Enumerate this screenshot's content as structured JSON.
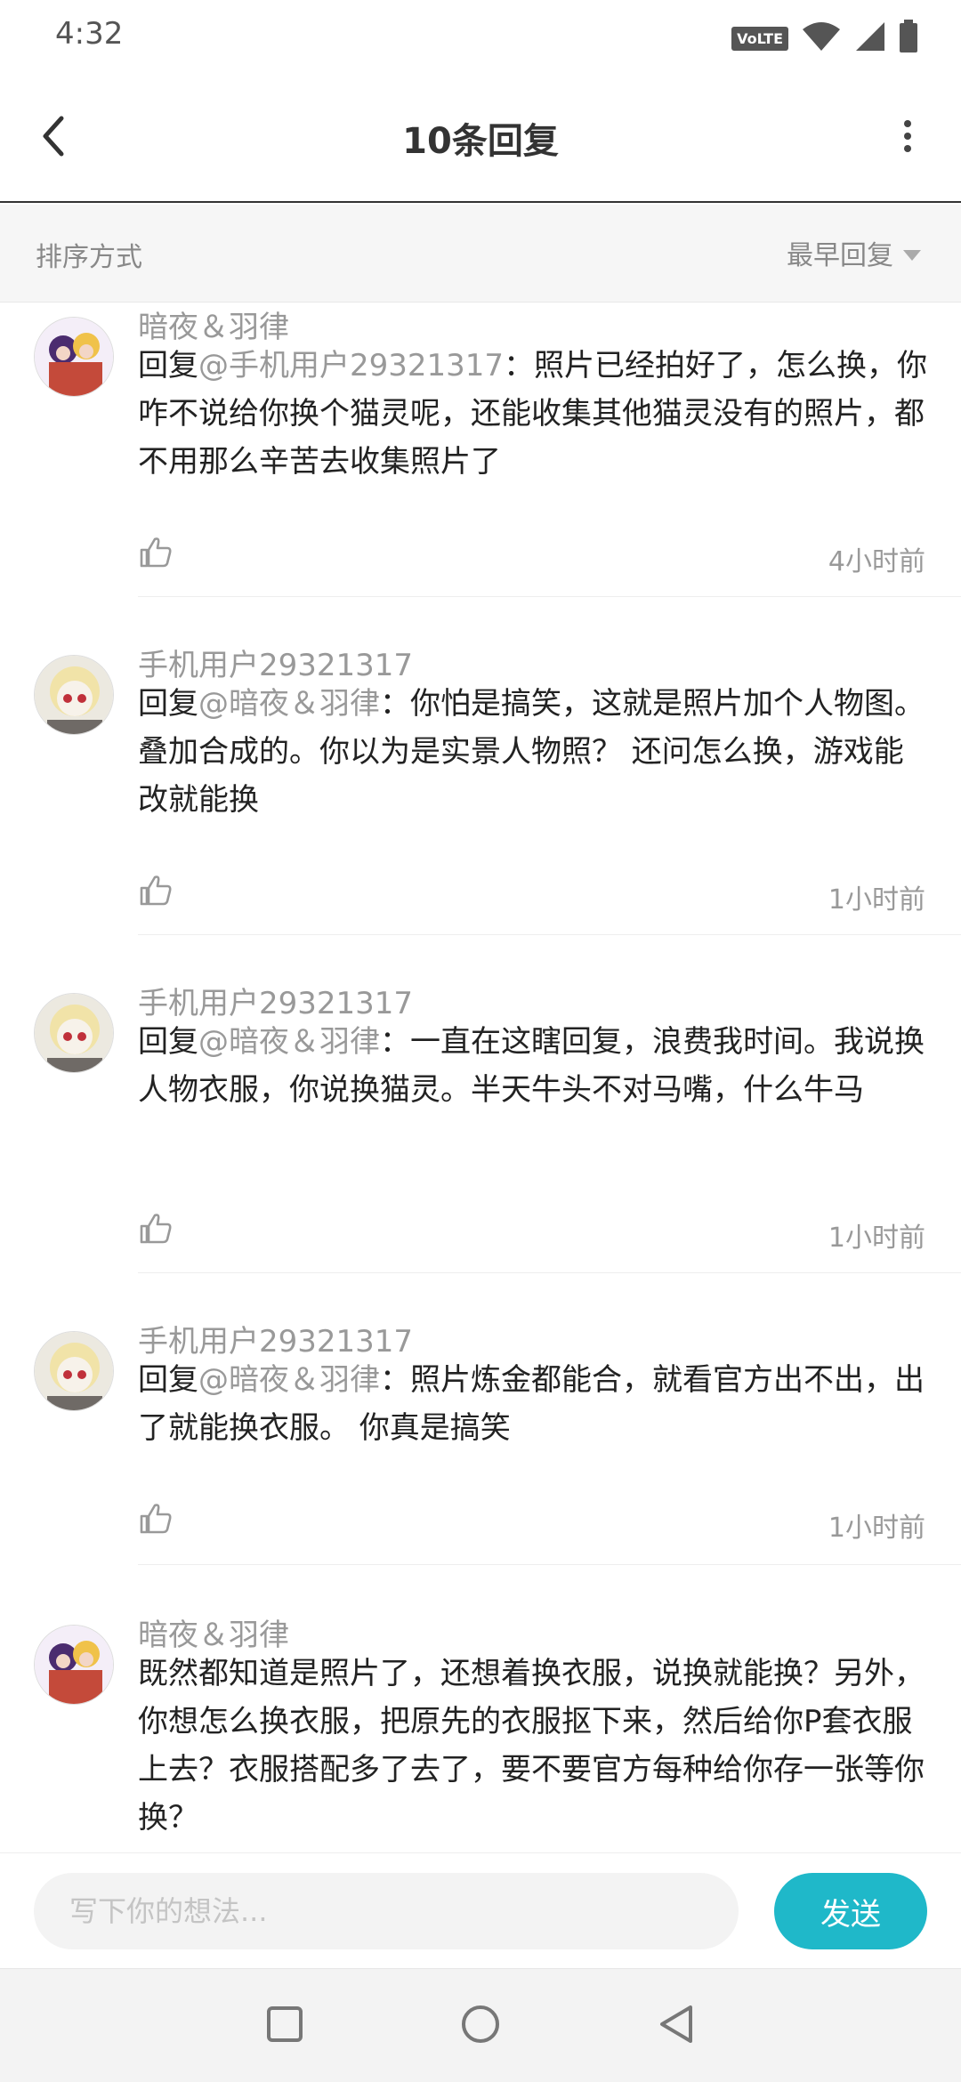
{
  "status_bar": {
    "time": "4:32",
    "volte": "VoLTE"
  },
  "header": {
    "title": "10条回复"
  },
  "sort_bar": {
    "label": "排序方式",
    "selected": "最早回复"
  },
  "comments": [
    {
      "username": "暗夜＆羽律",
      "prefix": "回复",
      "mention": "@手机用户29321317",
      "text": "：照片已经拍好了，怎么换，你咋不说给你换个猫灵呢，还能收集其他猫灵没有的照片，都不用那么辛苦去收集照片了",
      "time": "4小时前"
    },
    {
      "username": "手机用户29321317",
      "prefix": "回复",
      "mention": "@暗夜＆羽律",
      "text": "：你怕是搞笑，这就是照片加个人物图。叠加合成的。你以为是实景人物照？ 还问怎么换，游戏能改就能换",
      "time": "1小时前"
    },
    {
      "username": "手机用户29321317",
      "prefix": "回复",
      "mention": "@暗夜＆羽律",
      "text": "：一直在这瞎回复，浪费我时间。我说换人物衣服，你说换猫灵。半天牛头不对马嘴，什么牛马",
      "time": "1小时前"
    },
    {
      "username": "手机用户29321317",
      "prefix": "回复",
      "mention": "@暗夜＆羽律",
      "text": "：照片炼金都能合，就看官方出不出，出了就能换衣服。 你真是搞笑",
      "time": "1小时前"
    },
    {
      "username": "暗夜＆羽律",
      "prefix": "",
      "mention": "",
      "text": "既然都知道是照片了，还想着换衣服，说换就能换？另外，你想怎么换衣服，把原先的衣服抠下来，然后给你P套衣服上去？衣服搭配多了去了，要不要官方每种给你存一张等你换？",
      "time": ""
    }
  ],
  "input_bar": {
    "placeholder": "写下你的想法...",
    "send_label": "发送"
  },
  "colors": {
    "accent": "#1fb8c9",
    "muted_text": "#999999",
    "body_text": "#222222"
  },
  "icons": {
    "back": "chevron-left-icon",
    "more": "more-vertical-icon",
    "like": "thumbs-up-icon",
    "sort": "caret-down-icon"
  }
}
